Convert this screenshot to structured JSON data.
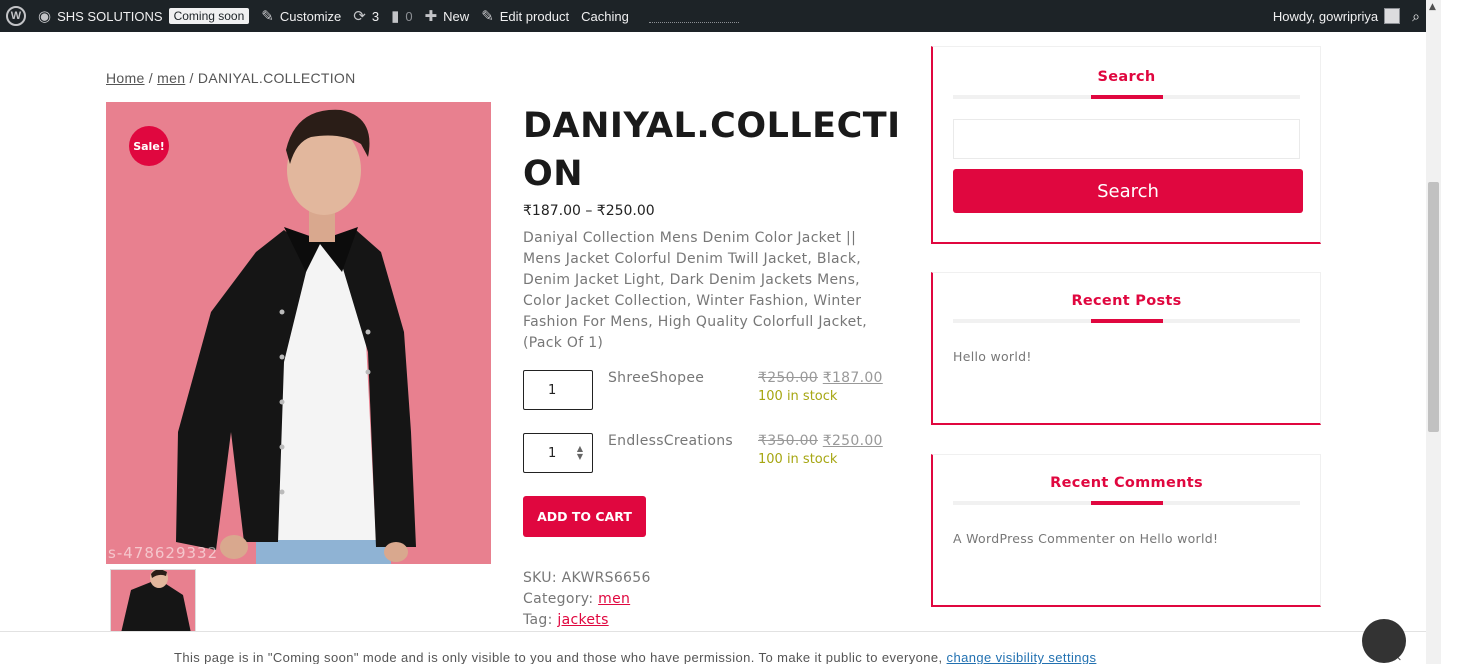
{
  "admin_bar": {
    "site_name": "SHS SOLUTIONS",
    "coming_soon": "Coming soon",
    "customize": "Customize",
    "updates_count": "3",
    "comments_count": "0",
    "new": "New",
    "edit_product": "Edit product",
    "caching": "Caching",
    "howdy": "Howdy, gowripriya"
  },
  "breadcrumb": {
    "home": "Home",
    "sep1": "/",
    "category": "men",
    "sep2": "/",
    "current": "DANIYAL.COLLECTION"
  },
  "product": {
    "sale_badge": "Sale!",
    "image_watermark": "s-478629332",
    "title": "DANIYAL.COLLECTION",
    "price_range": "₹187.00 – ₹250.00",
    "short_description": "Daniyal Collection Mens Denim Color Jacket || Mens Jacket Colorful Denim Twill Jacket, Black, Denim Jacket Light, Dark Denim Jackets Mens, Color Jacket Collection, Winter Fashion, Winter Fashion For Mens, High Quality Colorfull Jacket, (Pack Of 1)",
    "grouped_items": [
      {
        "qty": "1",
        "vendor": "ShreeShopee",
        "old_price": "₹250.00",
        "new_price": "₹187.00",
        "stock": "100 in stock"
      },
      {
        "qty": "1",
        "vendor": "EndlessCreations",
        "old_price": "₹350.00",
        "new_price": "₹250.00",
        "stock": "100 in stock"
      }
    ],
    "add_to_cart": "ADD TO CART",
    "sku_label": "SKU:",
    "sku": "AKWRS6656",
    "category_label": "Category:",
    "category": "men",
    "tag_label": "Tag:",
    "tag": "jackets"
  },
  "sidebar": {
    "search": {
      "title": "Search",
      "input_value": "",
      "button": "Search"
    },
    "recent_posts": {
      "title": "Recent Posts",
      "items": [
        "Hello world!"
      ]
    },
    "recent_comments": {
      "title": "Recent Comments",
      "items": [
        "A WordPress Commenter on Hello world!"
      ]
    }
  },
  "notice": {
    "text": "This page is in \"Coming soon\" mode and is only visible to you and those who have permission. To make it public to everyone,",
    "link": "change visibility settings",
    "close": "×"
  },
  "colors": {
    "accent": "#e0073f",
    "admin_bar": "#1d2327",
    "image_bg": "#e8808f",
    "stock": "#a6a612"
  }
}
